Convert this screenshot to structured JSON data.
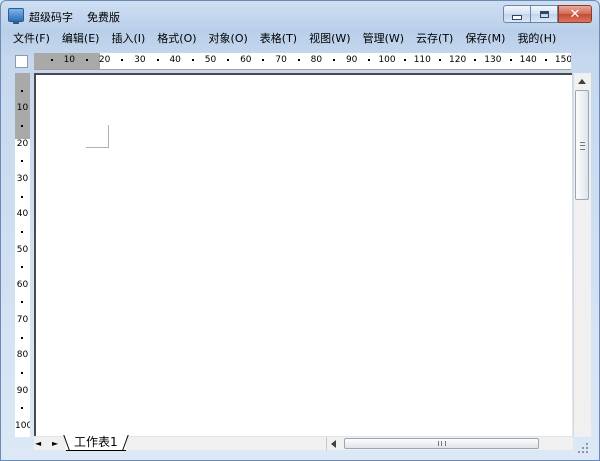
{
  "window": {
    "title": "超级码字    免费版",
    "close_glyph": "✕"
  },
  "menu": [
    "文件(F)",
    "编辑(E)",
    "插入(I)",
    "格式(O)",
    "对象(O)",
    "表格(T)",
    "视图(W)",
    "管理(W)",
    "云存(T)",
    "保存(M)",
    "我的(H)"
  ],
  "ruler": {
    "horizontal_labels": [
      "10",
      "20",
      "30",
      "40",
      "50",
      "60",
      "70",
      "80",
      "90",
      "100",
      "110",
      "120",
      "130",
      "140",
      "150"
    ],
    "vertical_labels": [
      "10",
      "20",
      "30",
      "40",
      "50",
      "60",
      "70",
      "80",
      "90",
      "100"
    ]
  },
  "sheet": {
    "tab_label": "工作表1",
    "nav_left": "◄",
    "nav_right": "►"
  },
  "colors": {
    "frame": "#c6d8ee",
    "page": "#ffffff",
    "ruler_margin": "#a9a9a9"
  }
}
